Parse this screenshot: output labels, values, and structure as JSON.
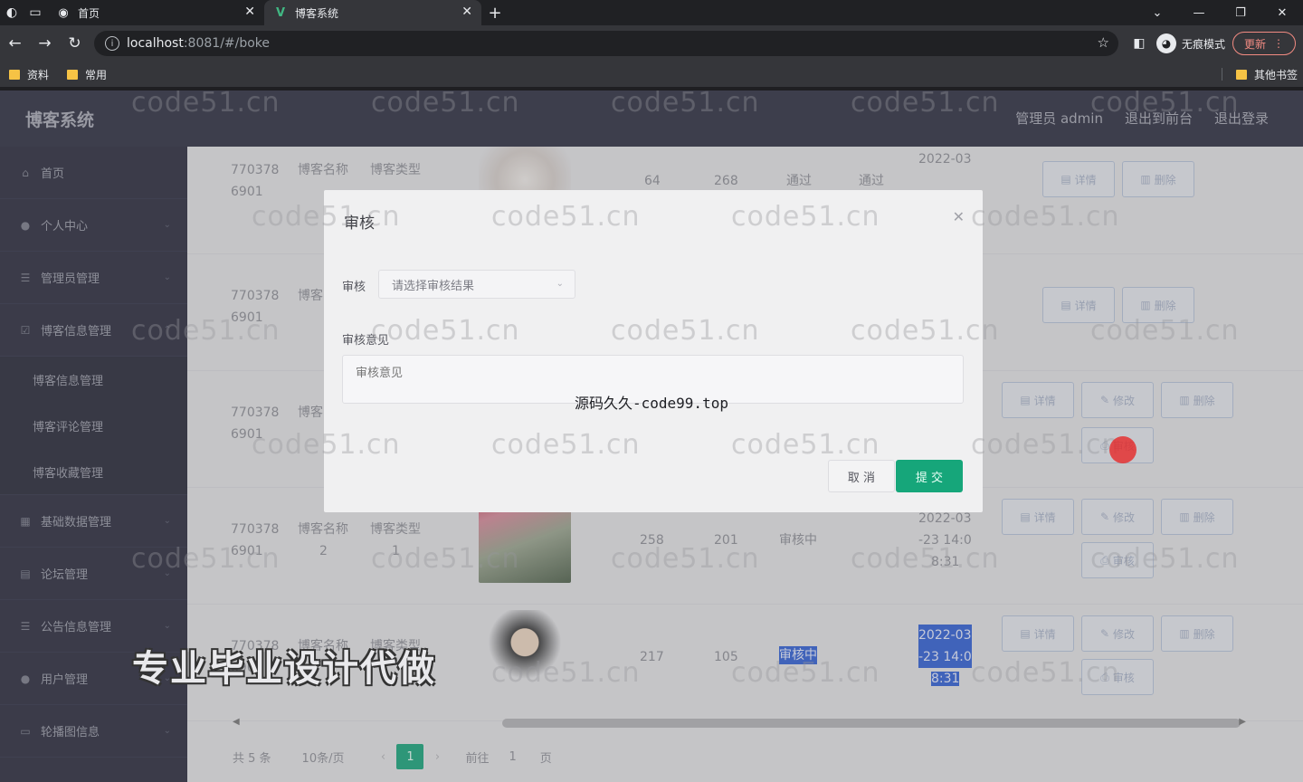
{
  "browser": {
    "tabs": [
      {
        "title": "首页",
        "active": false
      },
      {
        "title": "博客系统",
        "active": true
      }
    ],
    "url_host": "localhost",
    "url_path": ":8081/#/boke",
    "incognito_label": "无痕模式",
    "update_label": "更新",
    "bookmarks": [
      "资料",
      "常用"
    ],
    "other_bookmarks": "其他书签"
  },
  "app": {
    "brand": "博客系统",
    "top_links": [
      "管理员 admin",
      "退出到前台",
      "退出登录"
    ]
  },
  "sidebar": {
    "items": [
      {
        "label": "首页",
        "icon": "home-icon"
      },
      {
        "label": "个人中心",
        "icon": "user-icon"
      },
      {
        "label": "管理员管理",
        "icon": "list-icon"
      },
      {
        "label": "博客信息管理",
        "icon": "check-icon"
      }
    ],
    "sub_items": [
      "博客信息管理",
      "博客评论管理",
      "博客收藏管理"
    ],
    "items_after": [
      {
        "label": "基础数据管理",
        "icon": "grid-icon"
      },
      {
        "label": "论坛管理",
        "icon": "forum-icon"
      },
      {
        "label": "公告信息管理",
        "icon": "list-icon"
      },
      {
        "label": "用户管理",
        "icon": "pin-icon"
      },
      {
        "label": "轮播图信息",
        "icon": "image-icon"
      }
    ]
  },
  "table": {
    "rows": [
      {
        "id_a": "770378",
        "id_b": "6901",
        "name": "博客名称",
        "type": "博客类型",
        "likes": "64",
        "collects": "268",
        "status": "通过",
        "audit": "通过",
        "date": "2022-03"
      },
      {
        "id_a": "770378",
        "id_b": "6901",
        "name": "博客",
        "type": "",
        "likes": "",
        "collects": "",
        "status": "",
        "audit": "",
        "date": ""
      },
      {
        "id_a": "770378",
        "id_b": "6901",
        "name": "博客",
        "type": "",
        "likes": "",
        "collects": "",
        "status": "",
        "audit": "",
        "date": ""
      },
      {
        "id_a": "770378",
        "id_b": "6901",
        "name": "博客名称",
        "name2": "2",
        "type": "博客类型",
        "type2": "1",
        "likes": "258",
        "collects": "201",
        "status": "审核中",
        "date": "2022-03",
        "date2": "-23 14:0",
        "date3": "8:31"
      },
      {
        "id_a": "770378",
        "id_b": "6901",
        "name": "博客名称",
        "type": "博客类型",
        "likes": "217",
        "collects": "105",
        "status": "审核中",
        "date": "2022-03",
        "date2": "-23 14:0",
        "date3": "8:31"
      }
    ],
    "ops": {
      "detail": "详情",
      "edit": "修改",
      "delete": "删除",
      "audit": "审核"
    }
  },
  "pagination": {
    "total": "共 5 条",
    "page_size": "10条/页",
    "current": "1",
    "goto_prefix": "前往",
    "goto_value": "1",
    "goto_suffix": "页"
  },
  "dialog": {
    "title": "审核",
    "audit_label": "审核",
    "select_placeholder": "请选择审核结果",
    "opinion_label": "审核意见",
    "opinion_placeholder": "审核意见",
    "cancel": "取 消",
    "submit": "提 交"
  },
  "overlay_text": {
    "source": "源码久久-code99.top",
    "caption": "专业毕业设计代做",
    "watermark": "code51.cn"
  },
  "colors": {
    "accent": "#16a67a",
    "nav_bg": "#2a2b3d",
    "sidebar_bg": "#27283a"
  }
}
